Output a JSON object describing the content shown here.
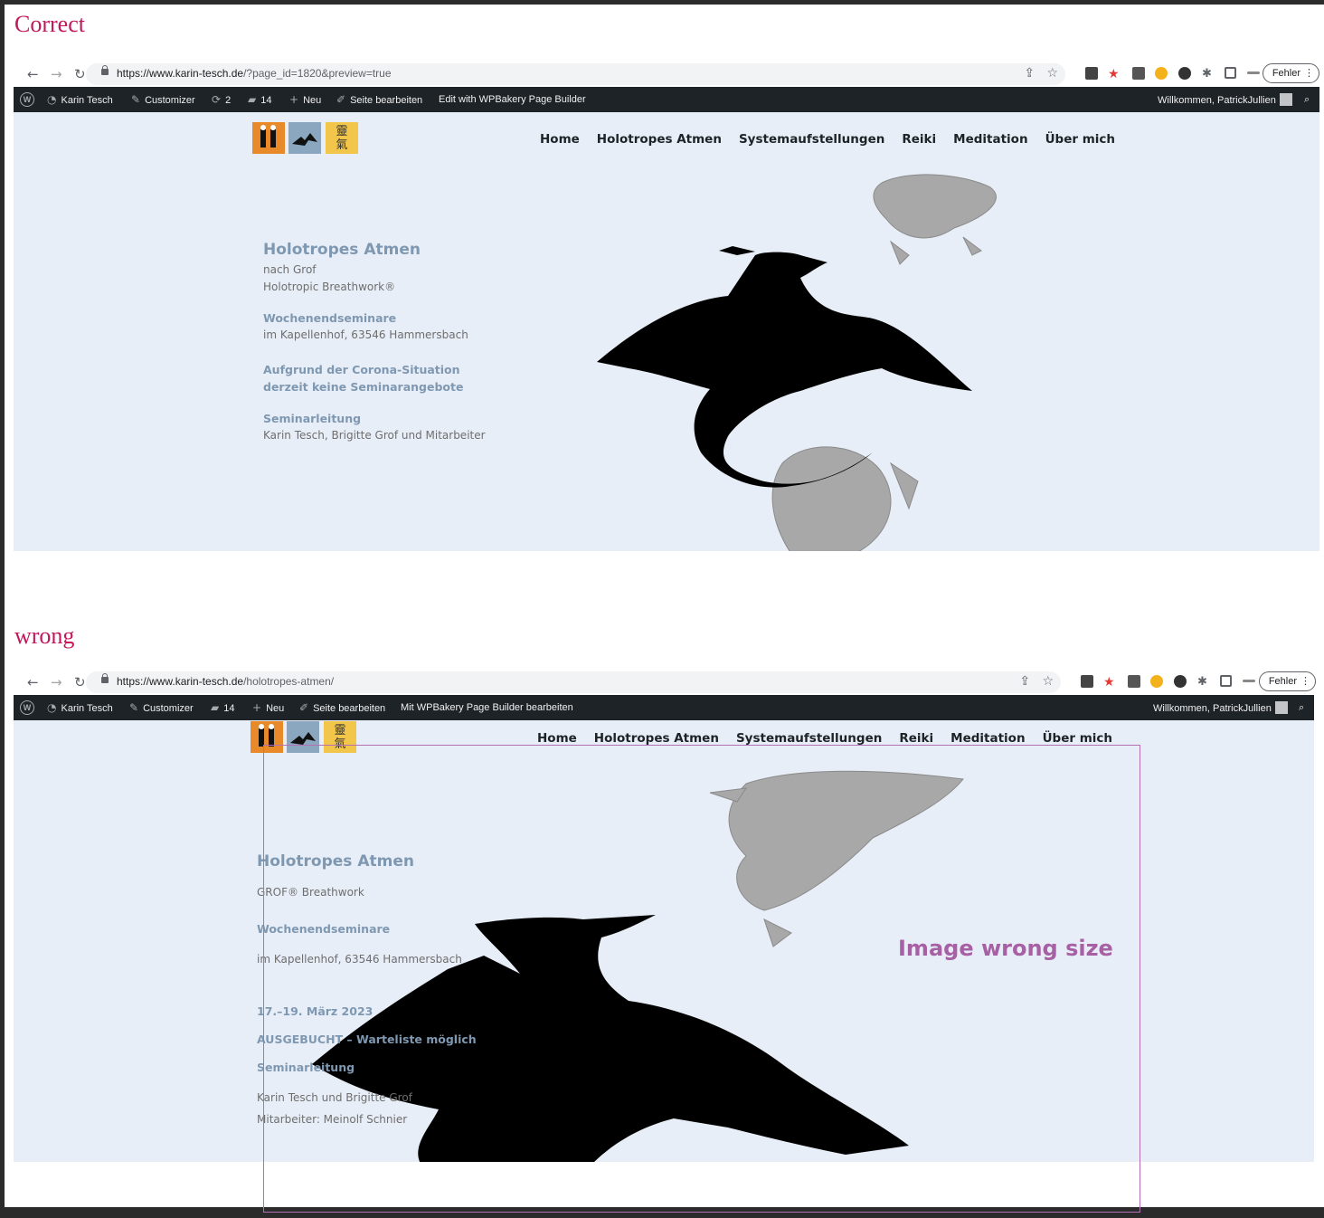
{
  "captions": {
    "correct": "Correct",
    "wrong": "wrong"
  },
  "browser": {
    "correct": {
      "url_host": "https://www.karin-tesch.de",
      "url_path": "/?page_id=1820&preview=true"
    },
    "wrong": {
      "url_host": "https://www.karin-tesch.de",
      "url_path": "/holotropes-atmen/"
    },
    "back_icon": "arrow-left-icon",
    "forward_icon": "arrow-right-icon",
    "reload_icon": "reload-icon",
    "fehler_label": "Fehler"
  },
  "adminbar": {
    "site_name": "Karin Tesch",
    "customizer": "Customizer",
    "updates_count": "2",
    "comments_count": "14",
    "new_label": "Neu",
    "edit_page": "Seite bearbeiten",
    "wpbakery_correct": "Edit with WPBakery Page Builder",
    "wpbakery_wrong": "Mit WPBakery Page Builder bearbeiten",
    "welcome": "Willkommen, PatrickJullien"
  },
  "site": {
    "nav": [
      "Home",
      "Holotropes Atmen",
      "Systemaufstellungen",
      "Reiki",
      "Meditation",
      "Über mich"
    ],
    "logo_tiles": [
      {
        "name": "couple-logo",
        "color": "#e98a2a"
      },
      {
        "name": "bird-logo",
        "color": "#8ba7bf"
      },
      {
        "name": "reiki-logo",
        "color": "#f2c64a",
        "glyph": "靈氣"
      }
    ]
  },
  "correct_page": {
    "title": "Holotropes Atmen",
    "subtitle1": "nach Grof",
    "subtitle2": "Holotropic Breathwork®",
    "h_seminars": "Wochenendseminare",
    "location": "im Kapellenhof, 63546 Hammersbach",
    "corona1": "Aufgrund der Corona-Situation",
    "corona2": "derzeit keine Seminarangebote",
    "h_leitung": "Seminarleitung",
    "leitung": "Karin Tesch, Brigitte Grof und Mitarbeiter"
  },
  "wrong_page": {
    "title": "Holotropes Atmen",
    "subtitle": "GROF® Breathwork",
    "h_seminars": "Wochenendseminare",
    "location": "im Kapellenhof, 63546 Hammersbach",
    "date": "17.–19. März 2023",
    "booked": "AUSGEBUCHT – Warteliste möglich",
    "h_leitung": "Seminarleitung",
    "leitung1": "Karin Tesch und Brigitte Grof",
    "leitung2": "Mitarbeiter: Meinolf Schnier",
    "annotation": "Image wrong size"
  },
  "colors": {
    "admin_bar": "#1d2327",
    "page_bg": "#e8eef7",
    "heading_blue": "#7f98b2",
    "caption_pink": "#c2185b",
    "annotation_purple": "#a760a4"
  }
}
